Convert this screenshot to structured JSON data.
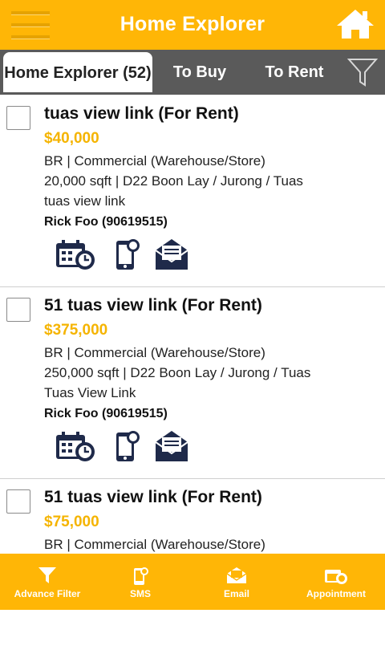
{
  "header": {
    "title": "Home Explorer"
  },
  "tabs": [
    {
      "label": "Home Explorer (52)",
      "active": true
    },
    {
      "label": "To Buy",
      "active": false
    },
    {
      "label": "To Rent",
      "active": false
    }
  ],
  "listings": [
    {
      "title": "tuas view link (For Rent)",
      "price": "$40,000",
      "type": "BR | Commercial  (Warehouse/Store)",
      "size_district": "20,000 sqft | D22 Boon Lay / Jurong / Tuas",
      "street": "tuas view link",
      "agent": "Rick Foo (90619515)"
    },
    {
      "title": "51 tuas view link (For Rent)",
      "price": "$375,000",
      "type": "BR | Commercial  (Warehouse/Store)",
      "size_district": "250,000 sqft | D22 Boon Lay / Jurong / Tuas",
      "street": "Tuas View Link",
      "agent": "Rick Foo (90619515)"
    },
    {
      "title": "51 tuas view link (For Rent)",
      "price": "$75,000",
      "type": "BR | Commercial  (Warehouse/Store)",
      "size_district": "",
      "street": "",
      "agent": ""
    }
  ],
  "bottom_nav": [
    {
      "label": "Advance Filter",
      "icon": "funnel-icon"
    },
    {
      "label": "SMS",
      "icon": "sms-icon"
    },
    {
      "label": "Email",
      "icon": "email-icon"
    },
    {
      "label": "Appointment",
      "icon": "appointment-icon"
    }
  ],
  "colors": {
    "accent": "#ffb606",
    "price": "#f5b400",
    "tab_bar": "#5a5a5a",
    "icon_navy": "#1f2a4a"
  }
}
